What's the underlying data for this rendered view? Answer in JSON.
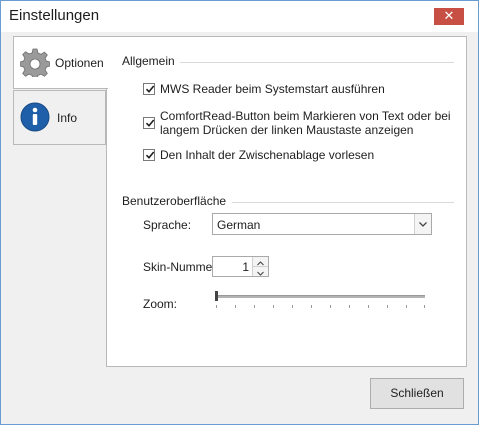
{
  "window": {
    "title": "Einstellungen",
    "close_glyph": "✕"
  },
  "tabs": [
    {
      "label": "Optionen",
      "icon": "gear-icon",
      "selected": true
    },
    {
      "label": "Info",
      "icon": "info-icon",
      "selected": false
    }
  ],
  "general": {
    "title": "Allgemein",
    "checkboxes": [
      {
        "label": "MWS Reader beim Systemstart ausführen",
        "checked": true
      },
      {
        "label_line1": "ComfortRead-Button beim Markieren von Text oder bei",
        "label_line2": "langem Drücken der linken Maustaste anzeigen",
        "checked": true
      },
      {
        "label": "Den Inhalt der Zwischenablage vorlesen",
        "checked": true
      }
    ]
  },
  "ui": {
    "title": "Benutzeroberfläche",
    "language_label": "Sprache:",
    "language_value": "German",
    "skin_label": "Skin-Nummer:",
    "skin_value": "1",
    "zoom_label": "Zoom:",
    "zoom_level": 0
  },
  "footer": {
    "close_label": "Schließen"
  },
  "colors": {
    "close_button": "#c74f43",
    "window_border": "#6a9bd1",
    "info_icon": "#1f5ea8"
  }
}
